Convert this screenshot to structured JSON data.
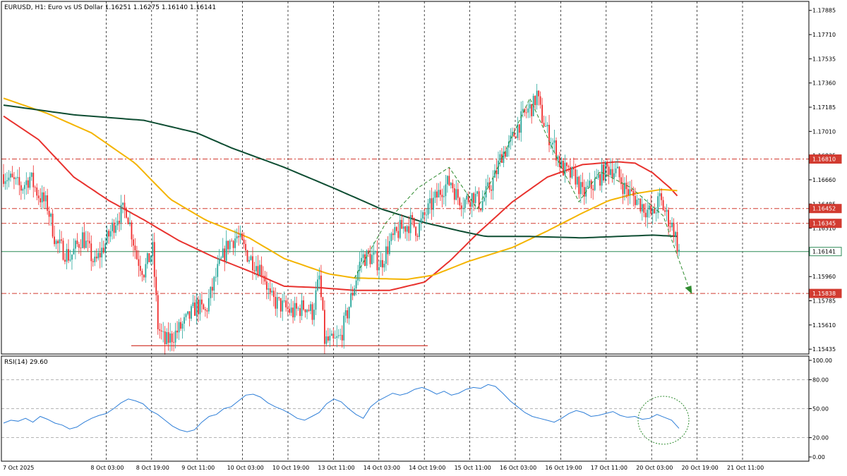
{
  "header": {
    "price_title": "EURUSD, H1:  Euro vs US Dollar  1.16251  1.16275  1.16140  1.16141",
    "rsi_title": "RSI(14) 29.60"
  },
  "colors": {
    "bull": "#26a69a",
    "bear": "#ef2b2b",
    "ma_fast": "#e8322e",
    "ma_mid": "#f4b400",
    "ma_slow": "#0e4d32",
    "level_line": "#d23b30",
    "current_line": "#2e8b57",
    "pattern": "#2e8b2e",
    "rsi_line": "#2f7fd8"
  },
  "chart_data": [
    {
      "type": "candlestick",
      "symbol": "EURUSD",
      "timeframe": "H1",
      "ylim": [
        1.154,
        1.1795
      ],
      "price_ticks": [
        "1.17885",
        "1.17710",
        "1.17535",
        "1.17360",
        "1.17185",
        "1.17010",
        "1.16835",
        "1.16660",
        "1.16485",
        "1.16310",
        "1.15960",
        "1.15785",
        "1.15610",
        "1.15435"
      ],
      "x_labels": [
        "7 Oct 2025",
        "8 Oct 03:00",
        "8 Oct 19:00",
        "9 Oct 11:00",
        "10 Oct 03:00",
        "10 Oct 19:00",
        "13 Oct 11:00",
        "14 Oct 03:00",
        "14 Oct 19:00",
        "15 Oct 11:00",
        "16 Oct 03:00",
        "16 Oct 19:00",
        "17 Oct 11:00",
        "20 Oct 03:00",
        "20 Oct 19:00",
        "21 Oct 11:00"
      ],
      "levels": [
        {
          "label": "1.16810",
          "value": 1.1681
        },
        {
          "label": "1.16452",
          "value": 1.16452
        },
        {
          "label": "1.16345",
          "value": 1.16345
        },
        {
          "label": "1.16141",
          "value": 1.16141,
          "current": true
        },
        {
          "label": "1.15838",
          "value": 1.15838
        }
      ],
      "support_line": {
        "value": 1.1546
      },
      "close_path": [
        [
          0,
          1.167
        ],
        [
          5,
          1.1665
        ],
        [
          10,
          1.166
        ],
        [
          15,
          1.1668
        ],
        [
          20,
          1.1655
        ],
        [
          25,
          1.1647
        ],
        [
          30,
          1.162
        ],
        [
          38,
          1.161
        ],
        [
          45,
          1.1625
        ],
        [
          52,
          1.1605
        ],
        [
          58,
          1.162
        ],
        [
          65,
          1.164
        ],
        [
          70,
          1.1645
        ],
        [
          73,
          1.1628
        ],
        [
          76,
          1.161
        ],
        [
          80,
          1.16
        ],
        [
          85,
          1.1615
        ],
        [
          88,
          1.156
        ],
        [
          92,
          1.1548
        ],
        [
          98,
          1.1555
        ],
        [
          105,
          1.1565
        ],
        [
          110,
          1.1575
        ],
        [
          115,
          1.157
        ],
        [
          122,
          1.16
        ],
        [
          128,
          1.162
        ],
        [
          133,
          1.1625
        ],
        [
          140,
          1.161
        ],
        [
          148,
          1.16
        ],
        [
          152,
          1.158
        ],
        [
          158,
          1.1575
        ],
        [
          165,
          1.157
        ],
        [
          172,
          1.1575
        ],
        [
          176,
          1.157
        ],
        [
          180,
          1.1595
        ],
        [
          183,
          1.155
        ],
        [
          188,
          1.1548
        ],
        [
          192,
          1.1552
        ],
        [
          196,
          1.157
        ],
        [
          200,
          1.159
        ],
        [
          204,
          1.161
        ],
        [
          210,
          1.161
        ],
        [
          215,
          1.1605
        ],
        [
          220,
          1.162
        ],
        [
          226,
          1.163
        ],
        [
          232,
          1.1635
        ],
        [
          236,
          1.163
        ],
        [
          240,
          1.164
        ],
        [
          245,
          1.165
        ],
        [
          250,
          1.166
        ],
        [
          255,
          1.1665
        ],
        [
          258,
          1.1655
        ],
        [
          262,
          1.165
        ],
        [
          268,
          1.1655
        ],
        [
          272,
          1.1648
        ],
        [
          276,
          1.1658
        ],
        [
          280,
          1.1668
        ],
        [
          284,
          1.1685
        ],
        [
          288,
          1.169
        ],
        [
          293,
          1.1705
        ],
        [
          298,
          1.1715
        ],
        [
          302,
          1.172
        ],
        [
          304,
          1.1728
        ],
        [
          306,
          1.1715
        ],
        [
          310,
          1.17
        ],
        [
          314,
          1.169
        ],
        [
          318,
          1.1675
        ],
        [
          322,
          1.167
        ],
        [
          326,
          1.1668
        ],
        [
          330,
          1.1655
        ],
        [
          334,
          1.166
        ],
        [
          338,
          1.1665
        ],
        [
          342,
          1.1672
        ],
        [
          346,
          1.1675
        ],
        [
          350,
          1.167
        ],
        [
          354,
          1.166
        ],
        [
          358,
          1.1655
        ],
        [
          362,
          1.165
        ],
        [
          366,
          1.1645
        ],
        [
          370,
          1.164
        ],
        [
          374,
          1.1652
        ],
        [
          378,
          1.164
        ],
        [
          382,
          1.163
        ],
        [
          385,
          1.1614
        ]
      ],
      "series": [
        {
          "name": "MA fast",
          "color": "#e8322e",
          "points": [
            [
              0,
              1.1712
            ],
            [
              20,
              1.1695
            ],
            [
              40,
              1.1668
            ],
            [
              60,
              1.1651
            ],
            [
              80,
              1.1637
            ],
            [
              100,
              1.1622
            ],
            [
              120,
              1.161
            ],
            [
              140,
              1.16
            ],
            [
              160,
              1.1589
            ],
            [
              180,
              1.1588
            ],
            [
              200,
              1.1586
            ],
            [
              220,
              1.1586
            ],
            [
              240,
              1.1592
            ],
            [
              255,
              1.1608
            ],
            [
              270,
              1.1627
            ],
            [
              290,
              1.165
            ],
            [
              310,
              1.1668
            ],
            [
              330,
              1.1677
            ],
            [
              350,
              1.1679
            ],
            [
              360,
              1.1678
            ],
            [
              370,
              1.1671
            ],
            [
              380,
              1.166
            ],
            [
              385,
              1.1653
            ]
          ]
        },
        {
          "name": "MA mid",
          "color": "#f4b400",
          "points": [
            [
              0,
              1.1725
            ],
            [
              25,
              1.1714
            ],
            [
              50,
              1.17
            ],
            [
              75,
              1.1678
            ],
            [
              95,
              1.1652
            ],
            [
              115,
              1.1637
            ],
            [
              140,
              1.1624
            ],
            [
              160,
              1.1609
            ],
            [
              185,
              1.1598
            ],
            [
              200,
              1.1595
            ],
            [
              230,
              1.1594
            ],
            [
              245,
              1.1597
            ],
            [
              265,
              1.1607
            ],
            [
              290,
              1.1617
            ],
            [
              310,
              1.1629
            ],
            [
              330,
              1.1642
            ],
            [
              345,
              1.1651
            ],
            [
              360,
              1.1656
            ],
            [
              375,
              1.1659
            ],
            [
              385,
              1.1658
            ]
          ]
        },
        {
          "name": "MA slow",
          "color": "#0e4d32",
          "points": [
            [
              0,
              1.172
            ],
            [
              40,
              1.1713
            ],
            [
              80,
              1.1709
            ],
            [
              110,
              1.17
            ],
            [
              130,
              1.1689
            ],
            [
              160,
              1.1675
            ],
            [
              190,
              1.1659
            ],
            [
              215,
              1.1645
            ],
            [
              240,
              1.1635
            ],
            [
              260,
              1.1629
            ],
            [
              275,
              1.1625
            ],
            [
              300,
              1.1625
            ],
            [
              330,
              1.1624
            ],
            [
              350,
              1.1625
            ],
            [
              370,
              1.1626
            ],
            [
              385,
              1.1625
            ]
          ]
        }
      ],
      "pattern_path": [
        [
          200,
          1.1595
        ],
        [
          218,
          1.1635
        ],
        [
          236,
          1.166
        ],
        [
          254,
          1.1675
        ],
        [
          270,
          1.1645
        ],
        [
          278,
          1.1665
        ],
        [
          300,
          1.1725
        ],
        [
          316,
          1.168
        ],
        [
          328,
          1.165
        ],
        [
          340,
          1.1672
        ],
        [
          358,
          1.166
        ],
        [
          376,
          1.164
        ],
        [
          390,
          1.159
        ]
      ]
    },
    {
      "type": "line",
      "name": "RSI(14)",
      "ylim": [
        0,
        100
      ],
      "y_ticks": [
        "100.00",
        "80.00",
        "50.00",
        "20.00",
        "0.00"
      ],
      "levels": [
        80,
        50,
        20
      ],
      "values": [
        35,
        38,
        37,
        40,
        36,
        42,
        39,
        35,
        33,
        29,
        31,
        36,
        40,
        43,
        45,
        50,
        56,
        60,
        58,
        55,
        48,
        44,
        38,
        32,
        28,
        26,
        28,
        36,
        42,
        44,
        50,
        52,
        58,
        64,
        65,
        62,
        56,
        52,
        49,
        45,
        40,
        38,
        42,
        46,
        55,
        60,
        57,
        50,
        44,
        40,
        52,
        58,
        62,
        66,
        64,
        66,
        70,
        72,
        69,
        65,
        68,
        64,
        66,
        70,
        72,
        71,
        75,
        73,
        66,
        58,
        52,
        46,
        42,
        40,
        38,
        36,
        40,
        45,
        48,
        46,
        42,
        43,
        45,
        47,
        43,
        41,
        42,
        39,
        40,
        44,
        41,
        38,
        29.6
      ]
    }
  ]
}
